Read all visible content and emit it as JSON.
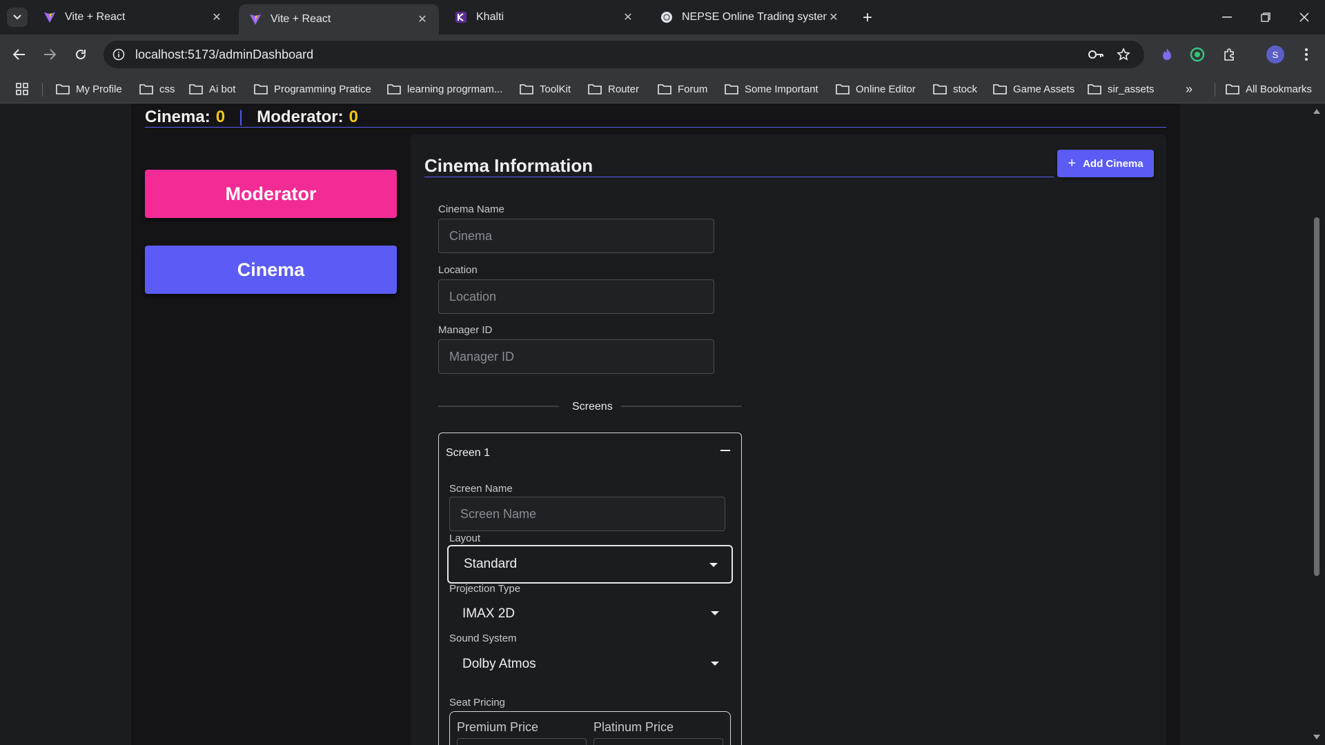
{
  "browser": {
    "tabs": [
      {
        "title": "Vite + React",
        "icon": "vite-icon"
      },
      {
        "title": "Vite + React",
        "icon": "vite-icon"
      },
      {
        "title": "Khalti",
        "icon": "khalti-icon"
      },
      {
        "title": "NEPSE Online Trading system",
        "icon": "globe-icon"
      }
    ],
    "url": "localhost:5173/adminDashboard",
    "profile_initial": "S",
    "bookmarks": [
      "My Profile",
      "css",
      "Ai bot",
      "Programming Pratice",
      "learning progrmam...",
      "ToolKit",
      "Router",
      "Forum",
      "Some Important",
      "Online Editor",
      "stock",
      "Game Assets",
      "sir_assets"
    ],
    "all_bookmarks": "All Bookmarks"
  },
  "header": {
    "cinema_label": "Cinema:",
    "cinema_count": "0",
    "separator": "|",
    "moderator_label": "Moderator:",
    "moderator_count": "0"
  },
  "sidebar": {
    "moderator": "Moderator",
    "cinema": "Cinema"
  },
  "form": {
    "title": "Cinema Information",
    "add_button": "Add Cinema",
    "cinema_name_label": "Cinema Name",
    "cinema_name_placeholder": "Cinema",
    "location_label": "Location",
    "location_placeholder": "Location",
    "manager_label": "Manager ID",
    "manager_placeholder": "Manager ID",
    "screens_divider": "Screens",
    "screen": {
      "title": "Screen 1",
      "screen_name_label": "Screen Name",
      "screen_name_placeholder": "Screen Name",
      "layout_label": "Layout",
      "layout_value": "Standard",
      "projection_label": "Projection Type",
      "projection_value": "IMAX 2D",
      "sound_label": "Sound System",
      "sound_value": "Dolby Atmos",
      "seat_pricing_label": "Seat Pricing",
      "premium_label": "Premium Price",
      "platinum_label": "Platinum Price"
    }
  },
  "colors": {
    "accent": "#5b5cf6",
    "moderator_pink": "#f22b95",
    "count_yellow": "#f5c518"
  }
}
